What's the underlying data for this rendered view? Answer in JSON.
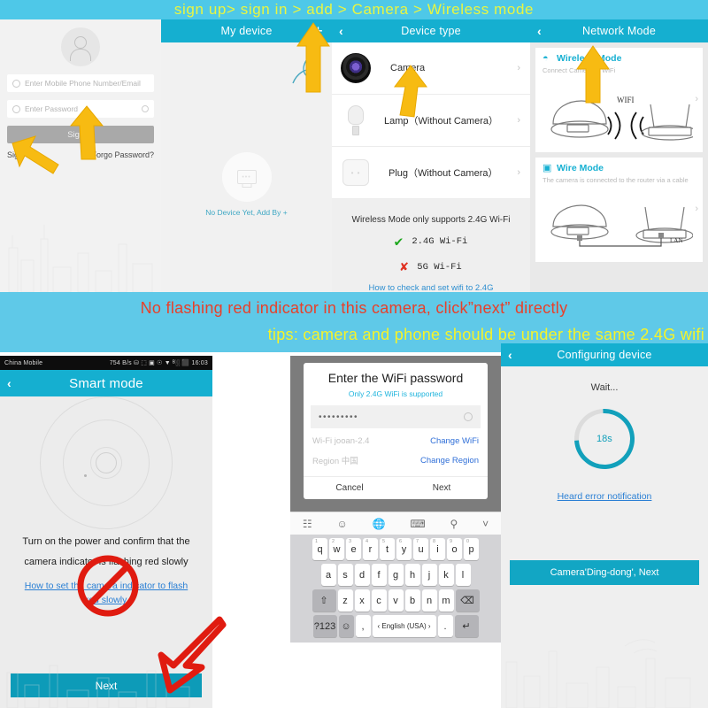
{
  "banner_top": {
    "text": "sign up> sign in > add > Camera > Wireless mode"
  },
  "banner_mid": {
    "line1": "No flashing red indicator in this camera, click”next” directly",
    "line2": "tips: camera and phone should be under the same 2.4G wifi",
    "color_line1": "#e8402a",
    "color_line2": "#f5f32a",
    "background": "#5fc9e8"
  },
  "colors": {
    "appbar": "#15afd0",
    "accent_button": "#12a6c4",
    "link": "#2a7fd4"
  },
  "login": {
    "phone_placeholder": "Enter Mobile Phone Number/Email",
    "password_placeholder": "Enter Password",
    "sign_in_label": "Sign In",
    "sign_up_label": "Sign Up",
    "forgot_label": "Forgo  Password?"
  },
  "my_device": {
    "title": "My device",
    "add_label": "+",
    "empty_text": "No Device Yet, Add By +"
  },
  "device_type": {
    "title": "Device type",
    "back": "‹",
    "rows": [
      {
        "label": "Camera",
        "chevron": "›"
      },
      {
        "label": "Lamp（Without Camera）",
        "chevron": "›"
      },
      {
        "label": "Plug（Without Camera）",
        "chevron": "›"
      }
    ],
    "note_title": "Wireless Mode only supports 2.4G Wi-Fi",
    "ok_mark": "✔",
    "ok_label": "2.4G Wi-Fi",
    "no_mark": "✘",
    "no_label": "5G  Wi-Fi",
    "note_link": "How to check and set wifi to 2.4G"
  },
  "network_mode": {
    "title": "Network Mode",
    "back": "‹",
    "cards": [
      {
        "title": "Wireless Mode",
        "subtitle": "Connect Camera to WiFi",
        "icon": "wifi-icon",
        "chevron": "›",
        "wifi_label": "WIFI"
      },
      {
        "title": "Wire Mode",
        "subtitle": "The camera is connected to the router via a cable",
        "icon": "ethernet-icon",
        "chevron": "›",
        "lan_label": "LAN"
      }
    ]
  },
  "smart_mode": {
    "statusbar": {
      "carrier": "China Mobile",
      "right": "754 B/s ⛁ ⬚ ▣ ☉ ▼ ᴮ░ ⬛ 16:03"
    },
    "title": "Smart mode",
    "back": "‹",
    "instruction_line1": "Turn on the power and confirm that the",
    "instruction_line2": "camera indicator is flashing red slowly",
    "help_link_line1": "How to set the camera indicator to flash",
    "help_link_line2": "red slowly",
    "next_label": "Next"
  },
  "wifi_dialog": {
    "title": "Enter the WiFi password",
    "subtitle": "Only 2.4G WiFi is supported",
    "password_value": "•••••••••",
    "eye_icon": "eye-icon",
    "wifi_row_label": "Wi-Fi jooan-2.4",
    "wifi_row_action": "Change WiFi",
    "region_row_label": "Region 中国",
    "region_row_action": "Change Region",
    "cancel_label": "Cancel",
    "next_label": "Next"
  },
  "keyboard": {
    "toolbar": [
      "grid-icon",
      "emoji-icon",
      "globe-icon",
      "clipboard-icon",
      "search-icon",
      "chevron-down-icon"
    ],
    "row1": [
      {
        "k": "q",
        "n": "1"
      },
      {
        "k": "w",
        "n": "2"
      },
      {
        "k": "e",
        "n": "3"
      },
      {
        "k": "r",
        "n": "4"
      },
      {
        "k": "t",
        "n": "5"
      },
      {
        "k": "y",
        "n": "6"
      },
      {
        "k": "u",
        "n": "7"
      },
      {
        "k": "i",
        "n": "8"
      },
      {
        "k": "o",
        "n": "9"
      },
      {
        "k": "p",
        "n": "0"
      }
    ],
    "row2": [
      "a",
      "s",
      "d",
      "f",
      "g",
      "h",
      "j",
      "k",
      "l"
    ],
    "row3_shift": "⇧",
    "row3": [
      "z",
      "x",
      "c",
      "v",
      "b",
      "n",
      "m"
    ],
    "row3_backspace": "⌫",
    "row4_symbols": "?123",
    "row4_emoji": "☺",
    "row4_comma": ",",
    "row4_space": "‹ English (USA) ›",
    "row4_period": ".",
    "row4_enter": "↵"
  },
  "configuring": {
    "title": "Configuring device",
    "back": "‹",
    "wait_label": "Wait...",
    "timer": "18s",
    "error_link": "Heard error notification",
    "next_label": "Camera'Ding-dong', Next"
  },
  "annotations": {
    "arrows": [
      {
        "name": "arrow-sign-up",
        "color": "#f5b800"
      },
      {
        "name": "arrow-sign-in",
        "color": "#f5b800"
      },
      {
        "name": "arrow-add-device",
        "color": "#f5b800"
      },
      {
        "name": "arrow-camera",
        "color": "#f5b800"
      },
      {
        "name": "arrow-wireless-mode",
        "color": "#f5b800"
      },
      {
        "name": "arrow-next-button",
        "color": "#e01b10"
      }
    ],
    "prohibition": {
      "name": "no-sign-icon",
      "color": "#e01b10"
    }
  }
}
